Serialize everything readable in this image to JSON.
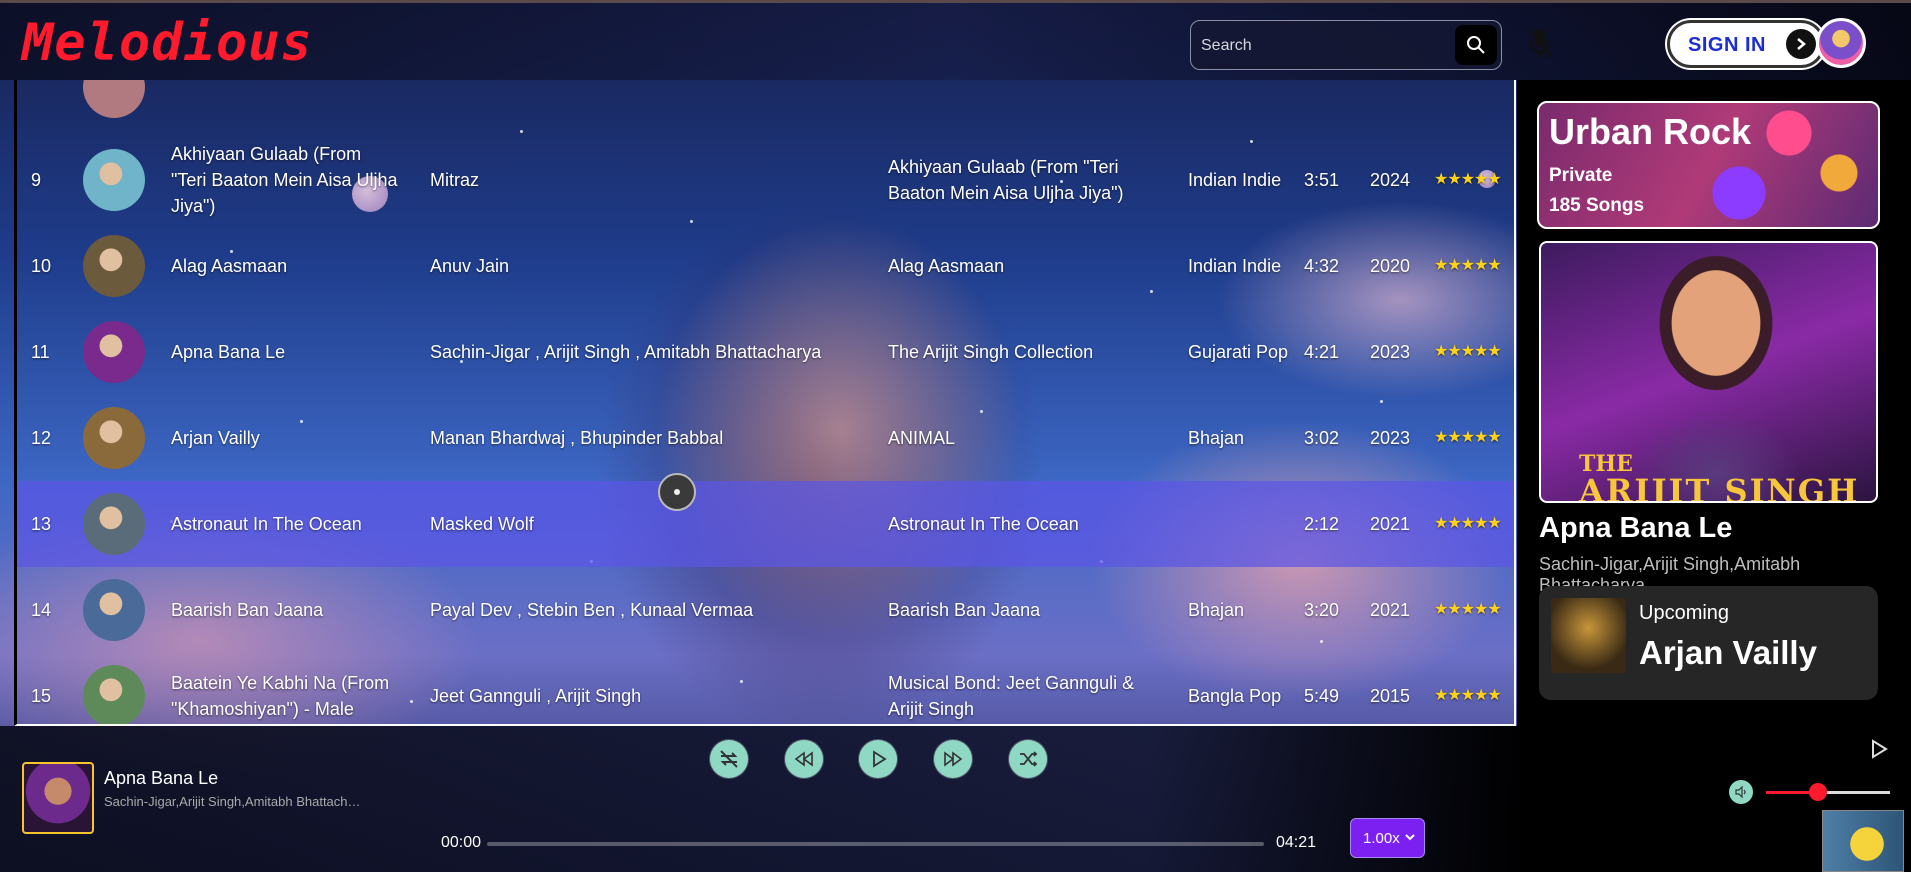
{
  "app": {
    "logo": "Melodious"
  },
  "header": {
    "search_placeholder": "Search",
    "sign_in_label": "SIGN IN"
  },
  "songs": [
    {
      "num": "9",
      "title": "Akhiyaan Gulaab (From \"Teri Baaton Mein Aisa Uljha Jiya\")",
      "artist": "Mitraz",
      "album": "Akhiyaan Gulaab (From \"Teri Baaton Mein Aisa Uljha Jiya\")",
      "genre": "Indian Indie",
      "duration": "3:51",
      "year": "2024",
      "rating": "★★★★★",
      "thumb_color": "#6fb4c9"
    },
    {
      "num": "10",
      "title": "Alag Aasmaan",
      "artist": "Anuv Jain",
      "album": "Alag Aasmaan",
      "genre": "Indian Indie",
      "duration": "4:32",
      "year": "2020",
      "rating": "★★★★★",
      "thumb_color": "#6b5a3c"
    },
    {
      "num": "11",
      "title": "Apna Bana Le",
      "artist": "Sachin-Jigar , Arijit Singh , Amitabh Bhattacharya",
      "album": "The Arijit Singh Collection",
      "genre": "Gujarati Pop",
      "duration": "4:21",
      "year": "2023",
      "rating": "★★★★★",
      "thumb_color": "#7a2a8c"
    },
    {
      "num": "12",
      "title": "Arjan Vailly",
      "artist": "Manan Bhardwaj , Bhupinder Babbal",
      "album": "ANIMAL",
      "genre": "Bhajan",
      "duration": "3:02",
      "year": "2023",
      "rating": "★★★★★",
      "thumb_color": "#8a6a3a"
    },
    {
      "num": "13",
      "title": "Astronaut In The Ocean",
      "artist": "Masked Wolf",
      "album": "Astronaut In The Ocean",
      "genre": "",
      "duration": "2:12",
      "year": "2021",
      "rating": "★★★★★",
      "thumb_color": "#5a6c7a",
      "active": true
    },
    {
      "num": "14",
      "title": "Baarish Ban Jaana",
      "artist": "Payal Dev , Stebin Ben , Kunaal Vermaa",
      "album": "Baarish Ban Jaana",
      "genre": "Bhajan",
      "duration": "3:20",
      "year": "2021",
      "rating": "★★★★★",
      "thumb_color": "#4a6b9a"
    },
    {
      "num": "15",
      "title": "Baatein Ye Kabhi Na (From \"Khamoshiyan\") - Male",
      "artist": "Jeet Gannguli , Arijit Singh",
      "album": "Musical Bond: Jeet Gannguli & Arijit Singh",
      "genre": "Bangla Pop",
      "duration": "5:49",
      "year": "2015",
      "rating": "★★★★★",
      "thumb_color": "#5e8a5a"
    }
  ],
  "sidebar": {
    "playlist": {
      "name": "Urban Rock",
      "visibility": "Private",
      "count": "185 Songs"
    },
    "cover_text_line1": "THE",
    "cover_text_line2": "ARIJIT SINGH",
    "now_playing": {
      "title": "Apna Bana Le",
      "artist": "Sachin-Jigar,Arijit Singh,Amitabh Bhattacharya"
    },
    "upcoming": {
      "label": "Upcoming",
      "title": "Arjan Vailly"
    }
  },
  "player": {
    "title": "Apna Bana Le",
    "artist": "Sachin-Jigar,Arijit Singh,Amitabh Bhattacharya",
    "current_time": "00:00",
    "total_time": "04:21",
    "progress": 0,
    "speed": "1.00x",
    "volume": 0.42,
    "controls": [
      "repeat-off-icon",
      "rewind-icon",
      "play-icon",
      "fast-forward-icon",
      "shuffle-icon"
    ]
  },
  "colors": {
    "brand": "#ff1a2c",
    "accent": "#7b20f0",
    "control": "#8fd9c4",
    "active_row": "#5c56e6",
    "star": "#ffd21a"
  }
}
